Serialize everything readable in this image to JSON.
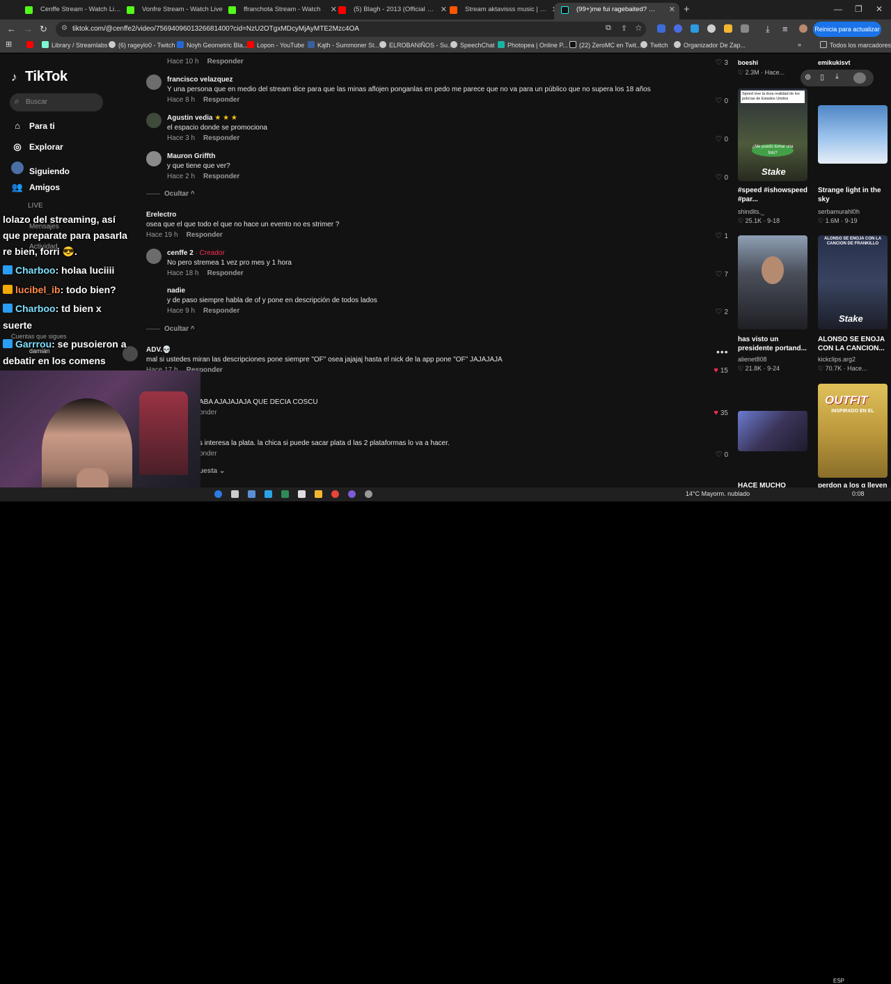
{
  "browser": {
    "tabs": [
      {
        "title": "Cenffe Stream - Watch Live on",
        "color": "#53fc18"
      },
      {
        "title": "Vonfre Stream - Watch Live",
        "color": "#53fc18"
      },
      {
        "title": "ffranchota Stream - Watch",
        "color": "#53fc18"
      },
      {
        "title": "(5) Blagh - 2013 (Official Video)",
        "color": "#ff0000"
      },
      {
        "title": "Stream aktavisss music | Listen",
        "color": "#ff5500"
      },
      {
        "title": "(99+)me fui ragebaited? xD #cl",
        "color": "#111111"
      }
    ],
    "url": "tiktok.com/@cenffe2/video/7569409601326681400?cid=NzU2OTgxMDcyMjAyMTE2Mzc4OA",
    "reinicia_label": "Reinicia para actualizar",
    "bookmarks": [
      "Library / Streamlabs",
      "(6) rageylo0 - Twitch",
      "Noyh Geometric Bla...",
      "Lopon - YouTube",
      "Kąth - Summoner St...",
      "ELROBANIÑOS - Su...",
      "SpeechChat",
      "Photopea | Online P...",
      "(22) ZeroMC en Twit...",
      "Twitch",
      "Organizador De Zap..."
    ],
    "bookmarks_all": "Todos los marcadores"
  },
  "tiktok": {
    "logo": "TikTok",
    "search_placeholder": "Buscar",
    "nav": [
      "Para ti",
      "Explorar",
      "Siguiendo",
      "Amigos",
      "LIVE",
      "Mensajes",
      "Actividad"
    ],
    "following_label": "Cuentas que sigues",
    "following_user": "damián",
    "reply_label": "Responder"
  },
  "comments": [
    {
      "author": "",
      "text": "",
      "time": "Hace 10 h",
      "likes": "3"
    },
    {
      "author": "francisco velazquez",
      "text": "Y una persona que en medio del stream dice para que las minas aflojen ponganlas en pedo me parece que no va para un público que no supera los 18 años",
      "time": "Hace 8 h",
      "likes": "0"
    },
    {
      "author": "Agustin vedia",
      "stars": "★ ★ ★",
      "text": "el espacio donde se promociona",
      "time": "Hace 3 h",
      "likes": "0"
    },
    {
      "author": "Mauron Griffth",
      "text": "y que tiene que ver?",
      "time": "Hace 2 h",
      "likes": "0"
    },
    {
      "author": "Erelectro",
      "text": "osea que el que todo el que no hace un evento no es strimer ?",
      "time": "Hace 19 h",
      "likes": "1"
    },
    {
      "author": "cenffe 2",
      "creator": "· Creador",
      "text": "No pero stremea 1 vez pro mes y 1 hora",
      "time": "Hace 18 h",
      "likes": "7"
    },
    {
      "author": "nadie",
      "text": "y de paso siempre habla de of y pone en descripción de todos lados",
      "time": "Hace 9 h",
      "likes": "2"
    },
    {
      "author": "ADV.💀",
      "text": "mal si ustedes miran las descripciones pone siempre \"OF\" osea jajajaj hasta el nick de la app pone \"OF\" JAJAJAJA",
      "time": "Hace 17 h",
      "likes": "15"
    },
    {
      "author": "",
      "text": "ABA AJAJAJAJA QUE DECIA COSCU",
      "time": "",
      "likes": "35"
    },
    {
      "author": "",
      "text": "s interesa la plata. la chica si puede sacar plata d las 2 plataformas lo va a hacer.",
      "time": "",
      "likes": "0"
    }
  ],
  "hide_label": "Ocultar",
  "replies_label": "uesta",
  "videos": [
    {
      "title": "",
      "author": "boeshi",
      "stats": "2.3M · Hace...",
      "color": "#222"
    },
    {
      "title": "",
      "author": "emikukisvt",
      "stats": "",
      "color": "#222"
    },
    {
      "title": "#speed #ishowspeed #par...",
      "author": "shindits._",
      "stats": "25.1K · 9-18",
      "color": "#5b6a3d"
    },
    {
      "title": "Strange light in the sky",
      "author": "serbamurahl0h",
      "stats": "1.6M · 9-19",
      "color": "#6f9ed6"
    },
    {
      "title": "has visto un presidente portand...",
      "author": "alienet808",
      "stats": "21.8K · 9-24",
      "color": "#505a6a"
    },
    {
      "title": "ALONSO SE ENOJA CON LA CANCION...",
      "author": "kickclips.arg2",
      "stats": "70.7K · Hace...",
      "color": "#2b3347"
    },
    {
      "title": "HACE MUCHO",
      "author": "",
      "stats": "",
      "color": "#3d3a5c"
    },
    {
      "title": "perdon a los q lleven",
      "author": "",
      "stats": "",
      "color": "#c7a04a"
    }
  ],
  "video_overlays": {
    "speed_caption": "Stake",
    "speed_top": "Speed vive la dura realidad de los policías de Estados Unidos",
    "speed_sign": "¿Me puedo tomar una foto?",
    "alonso_top": "ALONSO SE ENOJA CON LA CANCION DE FRANKILLO",
    "outfit_title": "OUTFIT",
    "outfit_sub": "INSPIRADO EN EL"
  },
  "chat": [
    {
      "user": "",
      "text": "lolazo del streaming, así"
    },
    {
      "user": "",
      "text": "que preparate para pasarla"
    },
    {
      "user": "",
      "text": "re bien, forri 😎."
    },
    {
      "user": "Charboo",
      "text": ": holaa luciiii"
    },
    {
      "user": "lucibel_ib",
      "text": ": todo bien?"
    },
    {
      "user": "Charboo",
      "text": ": td bien x"
    },
    {
      "user": "",
      "text": "suerte"
    },
    {
      "user": "Garrrou",
      "text": ": se pusoieron a"
    },
    {
      "user": "",
      "text": "debatir en los comens"
    }
  ],
  "taskbar": {
    "weather": "14°C  Mayorm. nublado",
    "lang": "ESP",
    "clock": "0:08"
  }
}
